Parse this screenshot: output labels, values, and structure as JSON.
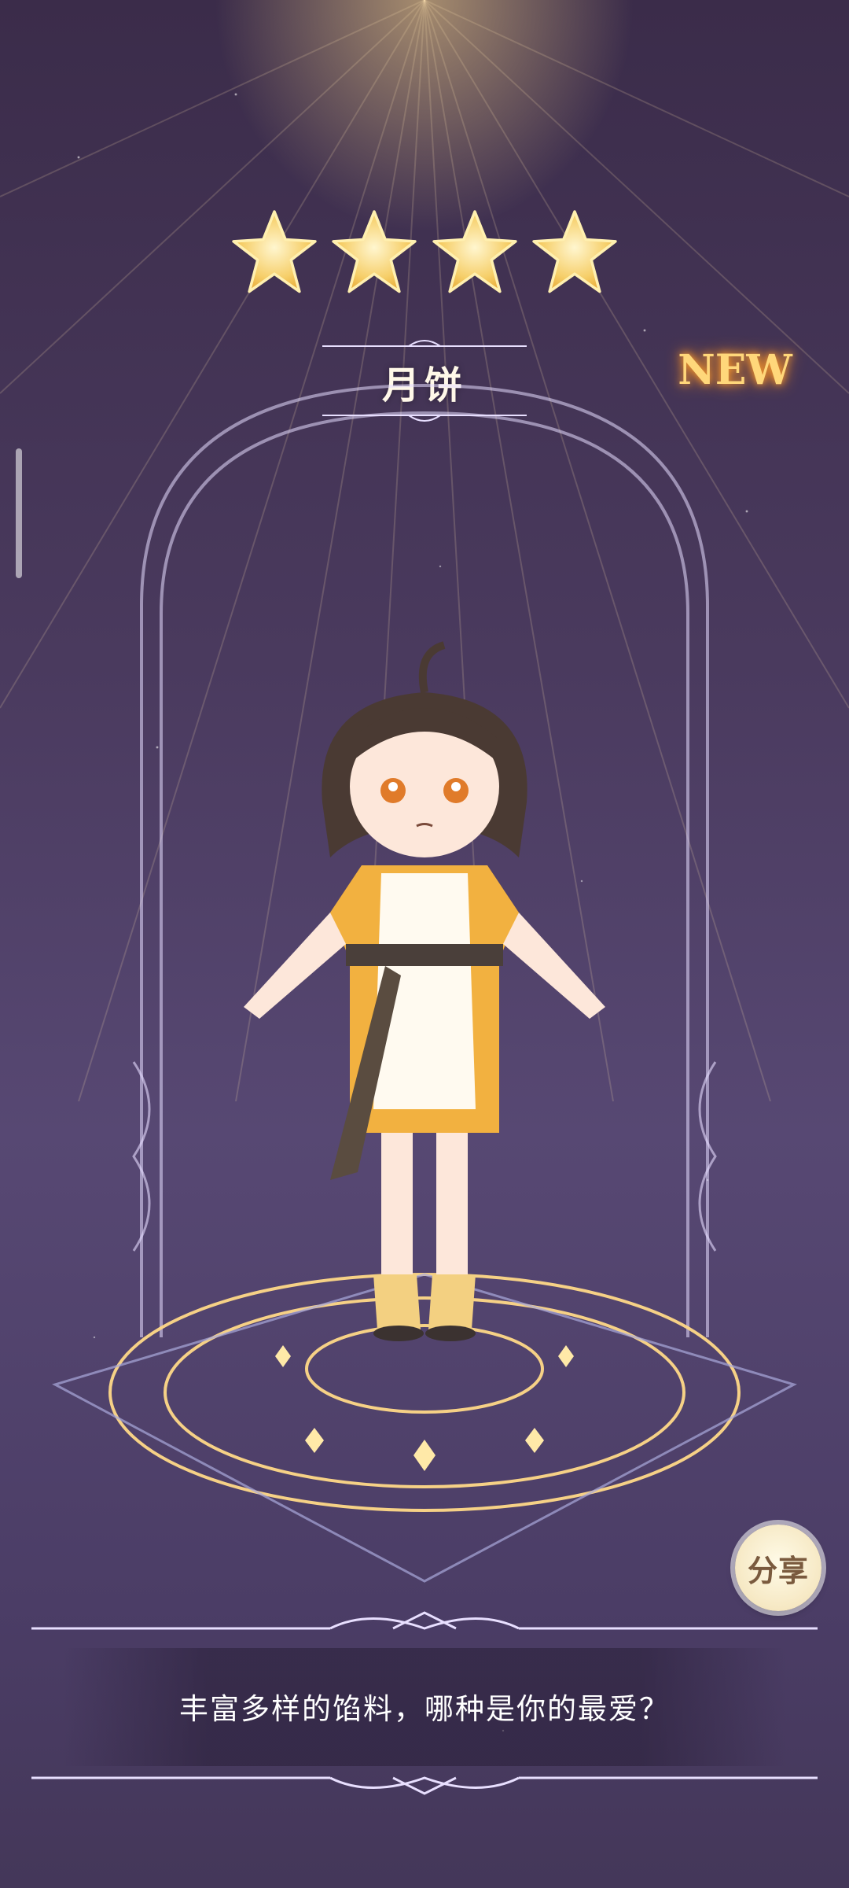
{
  "rarity": {
    "stars": 4,
    "max_stars": 4
  },
  "character": {
    "name": "月饼",
    "is_new": true,
    "badge_label": "NEW"
  },
  "actions": {
    "share_label": "分享"
  },
  "description": {
    "text": "丰富多样的馅料，哪种是你的最爱？"
  },
  "icons": {
    "star": "star-icon",
    "new": "new-badge",
    "share": "share-button"
  },
  "colors": {
    "star_fill": "#f6cf6a",
    "star_glow": "#ffe7a3",
    "new_text": "#ffd77a",
    "magic_circle": "#ffd988",
    "background_top": "#3b2c4a",
    "background_bottom": "#443759"
  }
}
